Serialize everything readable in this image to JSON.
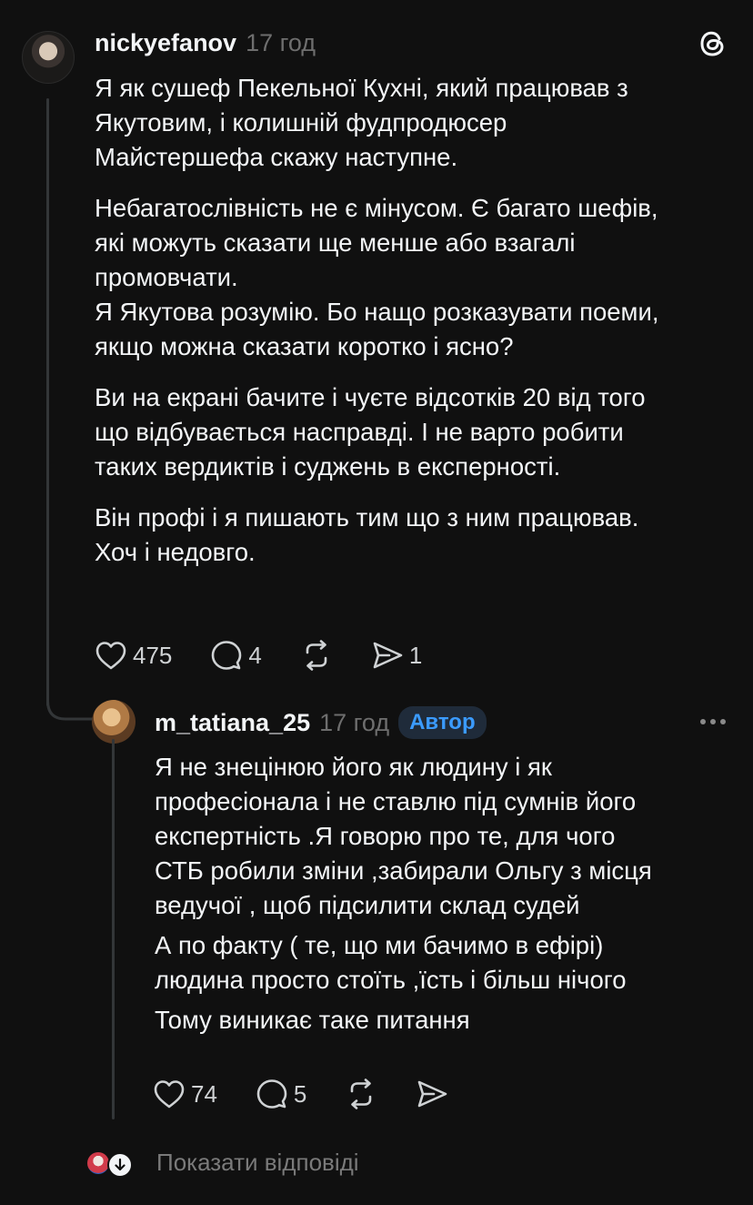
{
  "post": {
    "username": "nickyefanov",
    "time": "17 год",
    "paragraphs": [
      "Я як сушеф Пекельної Кухні, який працював з\nЯкутовим, і колишній фудпродюсер\nМайстершефа скажу наступне.",
      "Небагатослівність не є мінусом. Є багато шефів,\nякі можуть сказати ще менше або взагалі\nпромовчати.\nЯ Якутова розумію. Бо нащо розказувати поеми,\nякщо можна сказати коротко і ясно?",
      "Ви на екрані бачите і чуєте відсотків 20 від того\nщо відбувається насправді. І не варто робити\nтаких вердиктів і суджень в експерності.",
      "Він профі і я пишають тим що з ним працював.\nХоч і недовго."
    ],
    "likes": "475",
    "comments": "4",
    "shares": "1"
  },
  "reply": {
    "username": "m_tatiana_25",
    "time": "17 год",
    "badge": "Автор",
    "paragraphs": [
      "Я не знецінюю його як людину і як\nпрофесіонала і не ставлю під сумнів його\nекспертність .Я говорю про те, для чого\nСТБ робили зміни ,забирали Ольгу з місця\nведучої , щоб підсилити склад судей",
      "А по факту ( те, що ми бачимо в ефірі)\nлюдина просто стоїть ,їсть і більш нічого",
      "Тому виникає таке питання"
    ],
    "likes": "74",
    "comments": "5"
  },
  "show_replies": "Показати відповіді",
  "icons": {
    "app": "threads-logo-icon",
    "like": "heart-icon",
    "comment": "comment-bubble-icon",
    "repost": "repost-icon",
    "share": "send-icon",
    "more": "more-dots-icon"
  },
  "colors": {
    "background": "#101010",
    "text": "#f3f5f7",
    "muted": "#6e6e6e",
    "badge_text": "#3b9bff",
    "badge_bg": "#1f2b3a"
  }
}
